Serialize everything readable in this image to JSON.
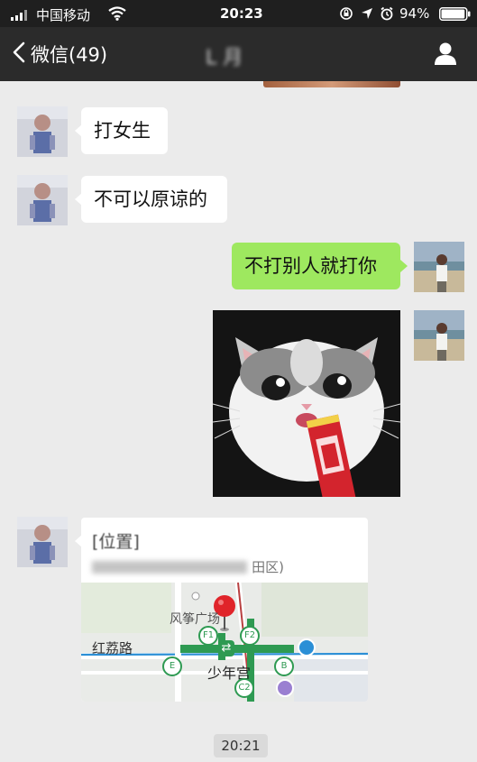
{
  "status_bar": {
    "carrier": "中国移动",
    "time": "20:23",
    "battery_percent": "94%",
    "battery_level": 0.94
  },
  "nav": {
    "back_label": "微信(49)",
    "title": "L  月"
  },
  "messages": [
    {
      "side": "left",
      "type": "text",
      "text": "打女生"
    },
    {
      "side": "left",
      "type": "text",
      "text": "不可以原谅的"
    },
    {
      "side": "right",
      "type": "text",
      "text": "不打别人就打你"
    },
    {
      "side": "right",
      "type": "image",
      "icon": "cat-photo"
    },
    {
      "side": "left",
      "type": "location"
    }
  ],
  "location": {
    "title": "[位置]",
    "address_suffix": "田区)",
    "map_labels": {
      "park": "风筝广场",
      "road": "红荔路",
      "station": "少年宫",
      "exit_f1": "F1",
      "exit_f2": "F2",
      "exit_e": "E",
      "exit_b": "B",
      "exit_c2": "C2"
    }
  },
  "timestamp": "20:21",
  "colors": {
    "nav_bg": "#2b2b2b",
    "status_bg": "#1f1f1f",
    "chat_bg": "#ebebeb",
    "bubble_sent": "#9ee85f",
    "bubble_received": "#ffffff",
    "map_pin": "#e0242a",
    "metro_green": "#2e9a52"
  }
}
